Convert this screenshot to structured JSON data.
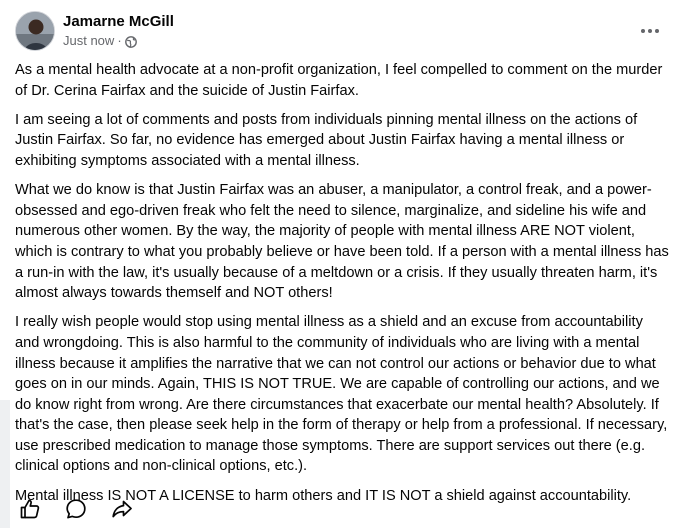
{
  "post": {
    "author": "Jamarne McGill",
    "timestamp": "Just now",
    "separator": "·",
    "privacy_icon": "globe-icon",
    "more_icon": "more-options-icon",
    "paragraphs": [
      "As a mental health advocate at a non-profit organization, I feel compelled to comment on the murder of Dr. Cerina Fairfax and the suicide of Justin Fairfax.",
      "I am seeing a lot of comments and posts from individuals pinning mental illness on the actions of Justin Fairfax. So far, no evidence has emerged about Justin Fairfax having a mental illness or exhibiting symptoms associated with a mental illness.",
      "What we do know is that Justin Fairfax was an abuser, a manipulator, a control freak, and a power-obsessed and ego-driven freak who felt the need to silence, marginalize, and sideline his wife and numerous other women. By the way, the majority of people with mental illness ARE NOT violent, which is contrary to what you probably believe or have been told. If a person with a mental illness has a run-in with the law, it's usually because of a meltdown or a crisis. If they usually threaten harm, it's almost always towards themself and NOT others!",
      "I really wish people would stop using mental illness as a shield and an excuse from accountability and wrongdoing. This is also harmful to the community of individuals who are living with a mental illness because it amplifies the narrative that we can not control our actions or behavior due to what goes on in our minds. Again, THIS IS NOT TRUE. We are capable of controlling our actions, and we do know right from wrong. Are there circumstances that exacerbate our mental health? Absolutely. If that's the case, then please seek help in the form of therapy or help from a professional. If necessary, use prescribed medication to manage those symptoms. There are support services out there (e.g. clinical options and non-clinical options, etc.).",
      "Mental illness IS NOT A LICENSE to harm others and IT IS NOT a shield against accountability."
    ]
  },
  "actions": [
    {
      "icon": "like-icon"
    },
    {
      "icon": "comment-icon"
    },
    {
      "icon": "share-icon"
    }
  ],
  "colors": {
    "text": "#050505",
    "secondary_text": "#65676b",
    "background": "#ffffff"
  }
}
